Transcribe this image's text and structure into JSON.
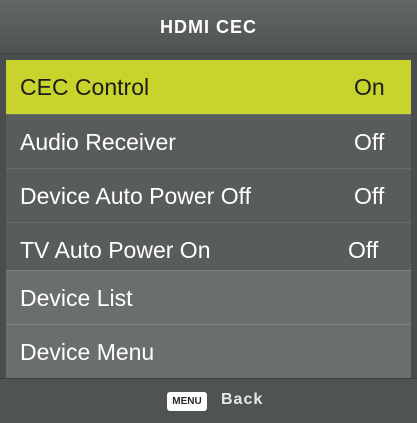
{
  "header": {
    "title": "HDMI CEC"
  },
  "items": [
    {
      "label": "CEC Control",
      "value": "On"
    },
    {
      "label": "Audio Receiver",
      "value": "Off"
    },
    {
      "label": "Device Auto Power Off",
      "value": "Off"
    },
    {
      "label": "TV Auto Power On",
      "value": "Off"
    },
    {
      "label": "Device List",
      "value": ""
    },
    {
      "label": "Device Menu",
      "value": ""
    }
  ],
  "selected_index": 0,
  "footer": {
    "key_label": "MENU",
    "action_label": "Back"
  },
  "colors": {
    "selected_background": "#c8d42c",
    "panel_background": "#4a4d4d"
  }
}
